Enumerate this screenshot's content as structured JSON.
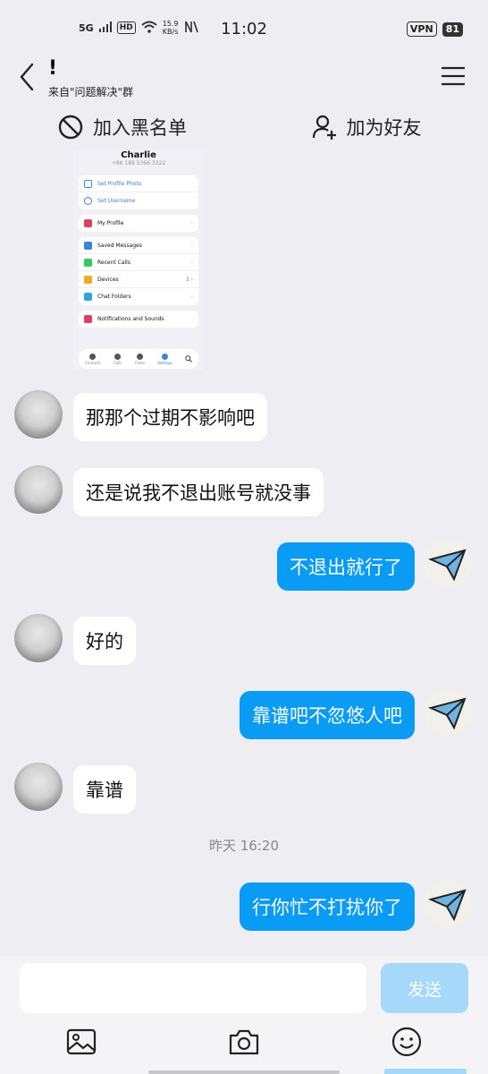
{
  "status_bar": {
    "network": "5G",
    "hd": "HD",
    "speed_value": "15.9",
    "speed_unit": "KB/s",
    "time": "11:02",
    "vpn": "VPN",
    "battery": "81"
  },
  "header": {
    "title": "!",
    "subtitle": "来自\"问题解决\"群"
  },
  "actions": {
    "block": "加入黑名单",
    "add_friend": "加为好友"
  },
  "shared_image": {
    "name": "Charlie",
    "phone": "+86 189 5366 3322",
    "group1": [
      "Set Profile Photo",
      "Set Username"
    ],
    "group2": [
      "My Profile"
    ],
    "group3": [
      "Saved Messages",
      "Recent Calls",
      "Devices",
      "Chat Folders"
    ],
    "devices_count": "3",
    "group4": [
      "Notifications and Sounds"
    ],
    "tabs": [
      "Contacts",
      "Calls",
      "Chats",
      "Settings"
    ]
  },
  "messages": [
    {
      "side": "left",
      "text": "那那个过期不影响吧"
    },
    {
      "side": "left",
      "text": "还是说我不退出账号就没事"
    },
    {
      "side": "right",
      "text": "不退出就行了"
    },
    {
      "side": "left",
      "text": "好的"
    },
    {
      "side": "right",
      "text": "靠谱吧不忽悠人吧"
    },
    {
      "side": "left",
      "text": "靠谱"
    },
    {
      "side": "right",
      "text": "行你忙不打扰你了"
    }
  ],
  "timestamp": "昨天 16:20",
  "input": {
    "placeholder": "",
    "send_label": "发送"
  },
  "colors": {
    "background": "#ededf2",
    "outgoing_bubble": "#0a9bf5",
    "incoming_bubble": "#ffffff",
    "send_button": "#a6d8fb"
  }
}
